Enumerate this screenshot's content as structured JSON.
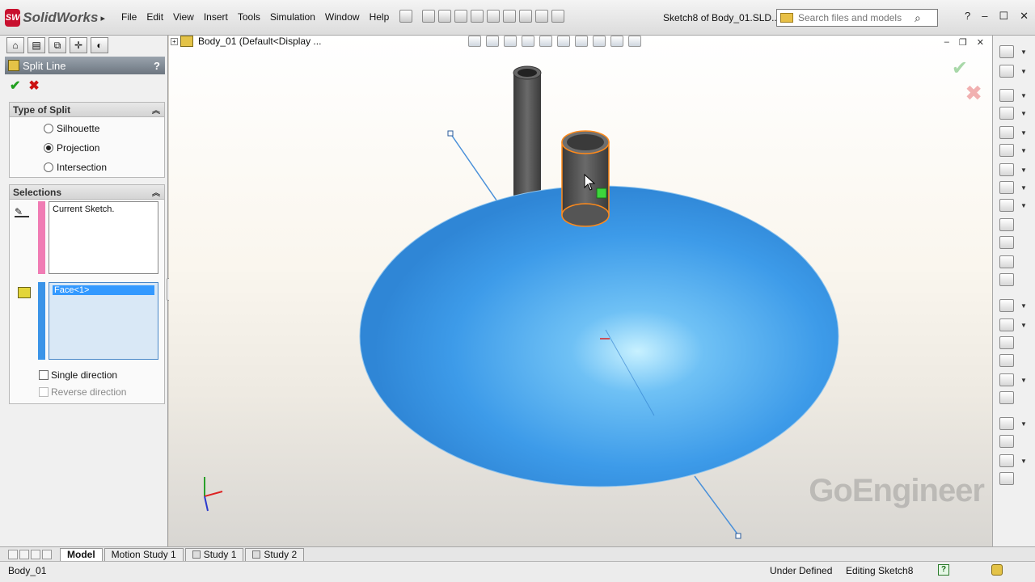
{
  "app": {
    "name": "SolidWorks",
    "logo_text": "SW",
    "menu": [
      "File",
      "Edit",
      "View",
      "Insert",
      "Tools",
      "Simulation",
      "Window",
      "Help"
    ],
    "doc_title": "Sketch8 of Body_01.SLD...",
    "search_placeholder": "Search files and models"
  },
  "property_manager": {
    "title": "Split Line",
    "help": "?",
    "type_of_split": {
      "header": "Type of Split",
      "options": [
        "Silhouette",
        "Projection",
        "Intersection"
      ],
      "selected": "Projection"
    },
    "selections": {
      "header": "Selections",
      "sketch_value": "Current Sketch.",
      "face_value": "Face<1>",
      "single_direction": "Single direction",
      "reverse_direction": "Reverse direction"
    }
  },
  "viewport": {
    "tree_root": "Body_01  (Default<Display ...",
    "watermark": "GoEngineer",
    "colors": {
      "body": "#3d9be9",
      "tube": "#505050",
      "highlight": "#ff8a1a",
      "sketch_line": "#4a90d9"
    }
  },
  "bottom_tabs": [
    "Model",
    "Motion Study 1",
    "Study 1",
    "Study 2"
  ],
  "active_tab": "Model",
  "status": {
    "left": "Body_01",
    "state": "Under Defined",
    "editing": "Editing Sketch8",
    "help_icon": "?"
  }
}
